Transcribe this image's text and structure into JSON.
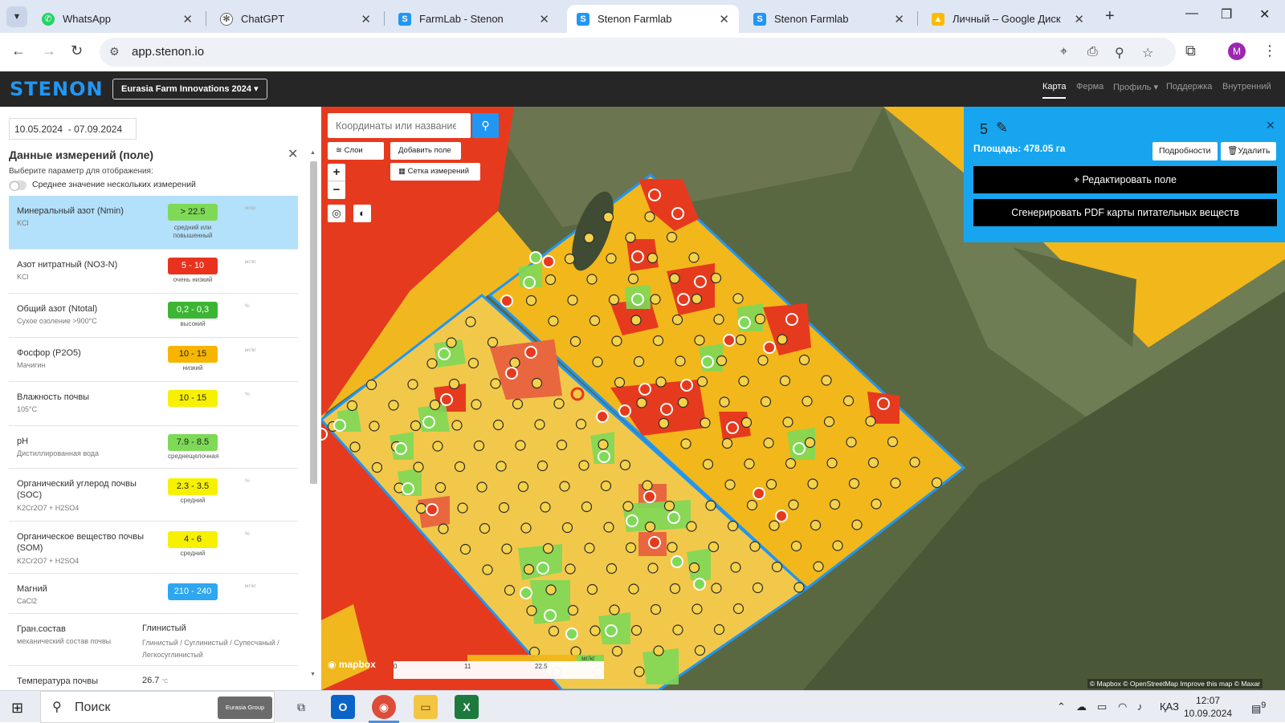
{
  "browser": {
    "tabs": [
      {
        "title": "WhatsApp",
        "icon": "whatsapp-icon",
        "color": "#25d366"
      },
      {
        "title": "ChatGPT",
        "icon": "chatgpt-icon",
        "color": "#555555"
      },
      {
        "title": "FarmLab - Stenon",
        "icon": "stenon-icon",
        "color": "#2196f3"
      },
      {
        "title": "Stenon Farmlab",
        "icon": "stenon-icon",
        "color": "#2196f3"
      },
      {
        "title": "Stenon Farmlab",
        "icon": "stenon-icon",
        "color": "#2196f3"
      },
      {
        "title": "Личный – Google Диск",
        "icon": "google-drive-icon",
        "color": "#fbbc04"
      }
    ],
    "active_tab_index": 3,
    "url": "app.stenon.io",
    "profile_initial": "M"
  },
  "app": {
    "logo": "STENON",
    "project": "Eurasia Farm Innovations 2024",
    "nav": [
      "Карта",
      "Ферма",
      "Профиль",
      "Поддержка",
      "Внутренний"
    ],
    "active_nav": "Карта"
  },
  "panel": {
    "date_from": "10.05.2024",
    "date_to": "07.09.2024",
    "title": "Данные измерений (поле)",
    "subtitle": "Выберите параметр для отображения:",
    "toggle_label": "Среднее значение нескольких измерений",
    "params": [
      {
        "name": "Минеральный азот (Nmin)",
        "method": "KCl",
        "value": "> 22.5",
        "level": "средний или повышенный",
        "unit": "мг/кг",
        "color": "#7ed957"
      },
      {
        "name": "Азот нитратный (NO3-N)",
        "method": "KCl",
        "value": "5 - 10",
        "level": "очень низкий",
        "unit": "мг/кг",
        "color": "#e8321e"
      },
      {
        "name": "Общий азот (Ntotal)",
        "method": "Сухое озоление >900°C",
        "value": "0,2 - 0,3",
        "level": "высокий",
        "unit": "%",
        "color": "#3cb534"
      },
      {
        "name": "Фосфор (P2O5)",
        "method": "Мачигин",
        "value": "10 - 15",
        "level": "низкий",
        "unit": "мг/кг",
        "color": "#f7b500"
      },
      {
        "name": "Влажность почвы",
        "method": "105°C",
        "value": "10 - 15",
        "level": "",
        "unit": "%",
        "color": "#f7f000"
      },
      {
        "name": "pH",
        "method": "Дистиллированная вода",
        "value": "7.9 - 8.5",
        "level": "среднещелочная",
        "unit": "",
        "color": "#7ed957"
      },
      {
        "name": "Органический углерод почвы (SOC)",
        "method": "K2Cr2O7 + H2SO4",
        "value": "2.3 - 3.5",
        "level": "средний",
        "unit": "%",
        "color": "#f7f000"
      },
      {
        "name": "Органическое вещество почвы (SOM)",
        "method": "K2Cr2O7 + H2SO4",
        "value": "4 - 6",
        "level": "средний",
        "unit": "%",
        "color": "#f7f000"
      },
      {
        "name": "Магний",
        "method": "CaCl2",
        "value": "210 - 240",
        "level": "",
        "unit": "мг/кг",
        "color": "#2ea6f0"
      }
    ],
    "texture": {
      "name": "Гран.состав",
      "method": "механический состав почвы",
      "value": "Глинистый",
      "options": "Глинистый / Суглинистый / Супесчаный / Легкосуглинистый"
    },
    "temperature": {
      "name": "Температура почвы",
      "value": "26.7",
      "unit": "°C"
    }
  },
  "map": {
    "search_placeholder": "Координаты или название п",
    "layers_label": "Слои",
    "add_field_label": "Добавить поле",
    "grid_label": "Сетка измерений",
    "mapbox_label": "mapbox",
    "legend": {
      "min": "0",
      "mid": "11",
      "max": "22.5",
      "unit": "мг/кг"
    },
    "attribution": "© Mapbox © OpenStreetMap  Improve this map © Maxar"
  },
  "field_popup": {
    "field_number": "5",
    "area": "Площадь: 478.05 га",
    "details_label": "Подробности",
    "delete_label": "Удалить",
    "edit_label": "Редактировать поле",
    "pdf_label": "Сгенерировать PDF карты питательных веществ"
  },
  "taskbar": {
    "search_text": "Поиск",
    "promo": "Eurasia Group",
    "lang": "ҚАЗ",
    "time": "12:07",
    "date": "10.09.2024",
    "notifications": "9"
  }
}
